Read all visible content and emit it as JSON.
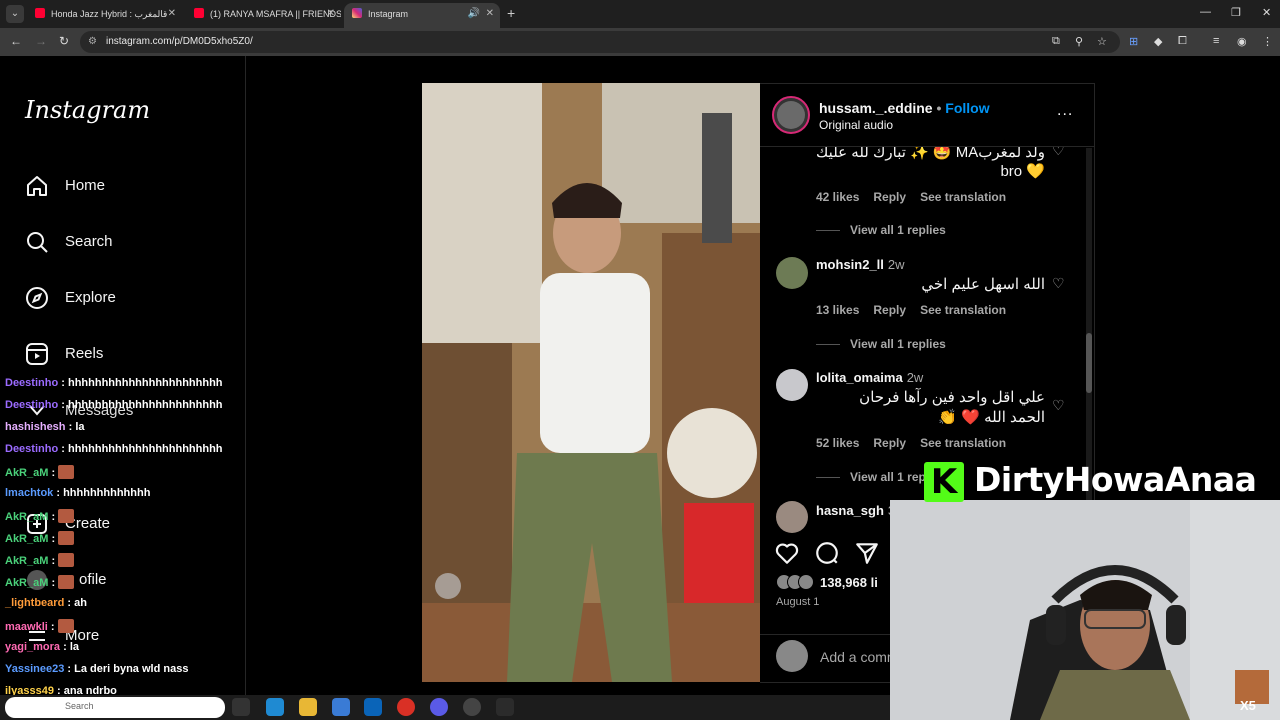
{
  "browser": {
    "tabs": [
      {
        "label": "Honda Jazz Hybrid : قالمغرب",
        "active": false
      },
      {
        "label": "(1) RANYA MSAFRA || FRIENDS",
        "active": false
      },
      {
        "label": "Instagram",
        "active": true
      }
    ],
    "url": "instagram.com/p/DM0D5xho5Z0/"
  },
  "sidebar": {
    "logo": "Instagram",
    "items": [
      {
        "label": "Home",
        "icon": "home-icon"
      },
      {
        "label": "Search",
        "icon": "search-icon"
      },
      {
        "label": "Explore",
        "icon": "compass-icon"
      },
      {
        "label": "Reels",
        "icon": "reels-icon"
      },
      {
        "label": "Messages",
        "icon": "messenger-icon"
      },
      {
        "label": "Create",
        "icon": "plus-icon"
      },
      {
        "label": "ofile",
        "icon": "avatar-icon"
      },
      {
        "label": "More",
        "icon": "menu-icon"
      }
    ]
  },
  "chat": [
    {
      "user": "Deestinho",
      "text": ": hhhhhhhhhhhhhhhhhhhhhhh",
      "color": "#9b6bff"
    },
    {
      "user": "Deestinho",
      "text": ": hhhhhhhhhhhhhhhhhhhhhhh",
      "color": "#9b6bff"
    },
    {
      "user": "hashishesh",
      "text": ": la",
      "color": "#e6b0ff"
    },
    {
      "user": "Deestinho",
      "text": ": hhhhhhhhhhhhhhhhhhhhhhh",
      "color": "#9b6bff"
    },
    {
      "user": "AkR_aM",
      "text": ":",
      "color": "#4ad17a",
      "emote": true
    },
    {
      "user": "lmachtok",
      "text": ": hhhhhhhhhhhhh",
      "color": "#5b9bff"
    },
    {
      "user": "AkR_aM",
      "text": ":",
      "color": "#4ad17a",
      "emote": true
    },
    {
      "user": "AkR_aM",
      "text": ":",
      "color": "#4ad17a",
      "emote": true
    },
    {
      "user": "AkR_aM",
      "text": ":",
      "color": "#4ad17a",
      "emote": true
    },
    {
      "user": "AkR_aM",
      "text": ":",
      "color": "#4ad17a",
      "emote": true
    },
    {
      "user": "_lightbeard",
      "text": ": ah",
      "color": "#ff9c3a"
    },
    {
      "user": "maawkli",
      "text": ":",
      "color": "#ff6ab3",
      "emote": true
    },
    {
      "user": "yagi_mora",
      "text": ": la",
      "color": "#ff6ab3"
    },
    {
      "user": "Yassinee23",
      "text": ": La deri byna wld nass",
      "color": "#5b9bff"
    },
    {
      "user": "ilyasss49",
      "text": ": ana ndrbo",
      "color": "#ffd24a"
    }
  ],
  "post": {
    "username": "hussam._.eddine",
    "separator": "•",
    "follow_label": "Follow",
    "audio": "Original audio",
    "more": "...",
    "comments": [
      {
        "text_line1": "ولد لمغربMA 🤩 ✨ تبارك لله عليك",
        "text_line2": "bro 💛",
        "likes": "42 likes",
        "reply": "Reply",
        "translate": "See translation",
        "view_replies": "View all 1 replies"
      },
      {
        "user": "mohsin2_ll",
        "time": "2w",
        "text": "الله اسهل عليم اخي",
        "likes": "13 likes",
        "reply": "Reply",
        "translate": "See translation",
        "view_replies": "View all 1 replies"
      },
      {
        "user": "lolita_omaima",
        "time": "2w",
        "text_line1": "علي اقل واحد فين رآها فرحان",
        "text_line2": "الحمد الله ❤️ 👏",
        "likes": "52 likes",
        "reply": "Reply",
        "translate": "See translation",
        "view_replies": "View all 1 rep"
      },
      {
        "user": "hasna_sgh",
        "time": "3"
      }
    ],
    "like_count": "138,968 li",
    "date": "August 1",
    "add_comment_placeholder": "Add a comm"
  },
  "overlay": {
    "kick_logo": "K",
    "channel_name": "DirtyHowaAnaa",
    "multiplier": "X5"
  },
  "taskbar": {
    "search_label": "Search"
  },
  "colors": {
    "follow": "#0095f6",
    "kick_green": "#53fc18",
    "like_heart": "#ed4956"
  }
}
